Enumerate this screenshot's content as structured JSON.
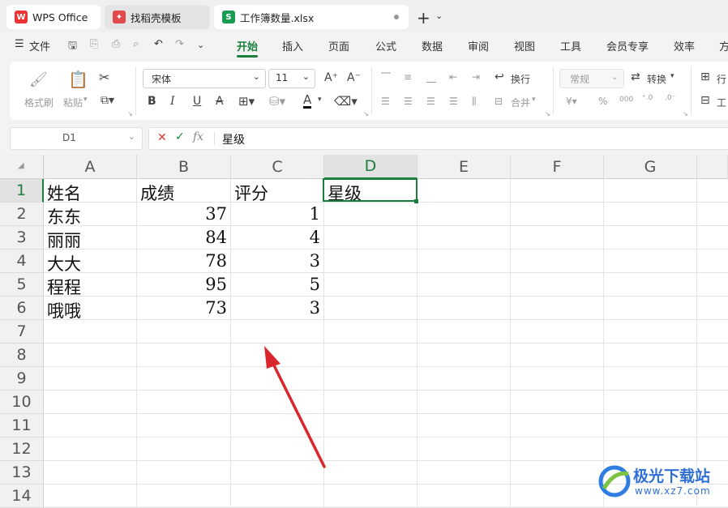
{
  "tabs": [
    {
      "label": "WPS Office"
    },
    {
      "label": "找稻壳模板"
    },
    {
      "label": "工作簿数量.xlsx"
    }
  ],
  "file_menu_label": "文件",
  "menu": [
    "开始",
    "插入",
    "页面",
    "公式",
    "数据",
    "审阅",
    "视图",
    "工具",
    "会员专享",
    "效率",
    "方"
  ],
  "ribbon": {
    "format_painter": "格式刷",
    "paste": "粘贴",
    "font_name": "宋体",
    "font_size": "11",
    "wrap": "换行",
    "merge": "合并",
    "number_format": "常规",
    "convert": "转换",
    "row_col": "行",
    "worksheet": "工",
    "bold": "B",
    "italic": "I",
    "underline": "U",
    "strike": "A"
  },
  "formula_bar": {
    "name_box": "D1",
    "fx": "fx",
    "content": "星级"
  },
  "columns": [
    "A",
    "B",
    "C",
    "D",
    "E",
    "F",
    "G"
  ],
  "rows": [
    "1",
    "2",
    "3",
    "4",
    "5",
    "6",
    "7",
    "8",
    "9",
    "10",
    "11",
    "12",
    "13",
    "14"
  ],
  "cells": {
    "A1": "姓名",
    "B1": "成绩",
    "C1": "评分",
    "D1": "星级",
    "A2": "东东",
    "B2": "37",
    "C2": "1",
    "A3": "丽丽",
    "B3": "84",
    "C3": "4",
    "A4": "大大",
    "B4": "78",
    "C4": "3",
    "A5": "程程",
    "B5": "95",
    "C5": "5",
    "A6": "哦哦",
    "B6": "73",
    "C6": "3"
  },
  "watermark": "极光下载站",
  "watermark_url": "www.xz7.com",
  "colors": {
    "accent": "#1a7f3c",
    "arrow": "#d9262c"
  }
}
